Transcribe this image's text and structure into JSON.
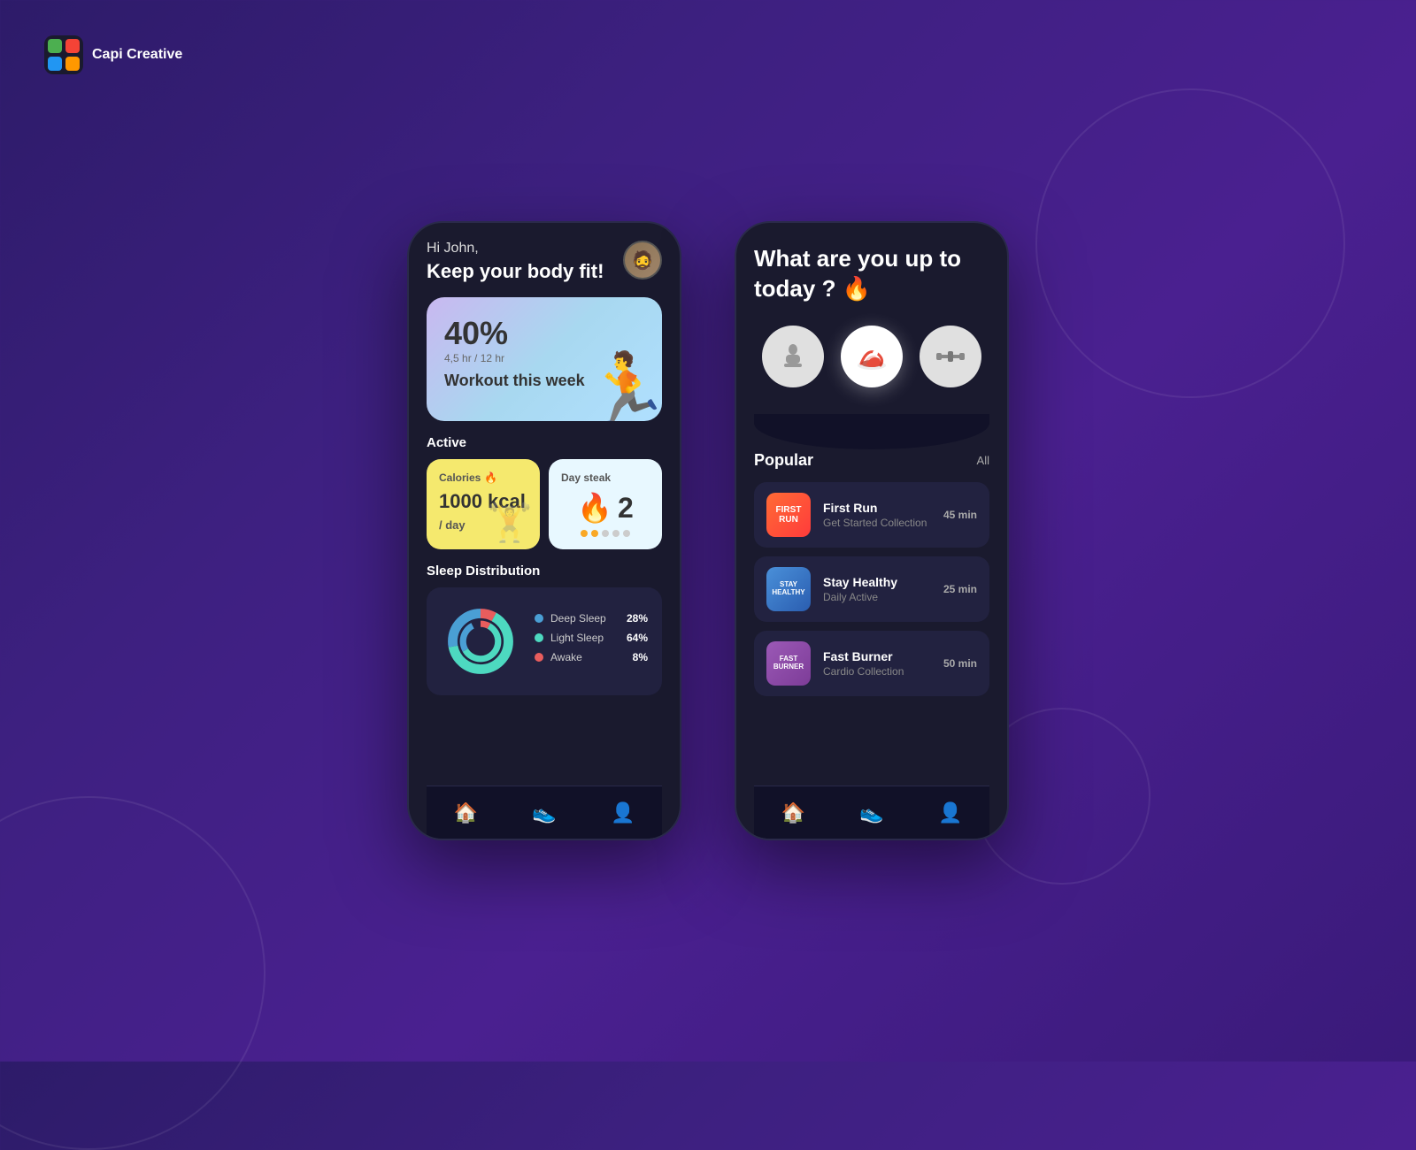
{
  "app": {
    "name": "Capi Creative",
    "logo_emoji": "🎨"
  },
  "phone1": {
    "greeting": "Hi John,",
    "title": "Keep your body fit!",
    "avatar_emoji": "🧔",
    "workout_percent": "40%",
    "workout_hours": "4,5 hr / 12 hr",
    "workout_label": "Workout this week",
    "figure_emoji": "🏋️",
    "active_label": "Active",
    "calories": {
      "label": "Calories",
      "value": "1000 kcal",
      "unit": "/ day",
      "emoji": "🔥"
    },
    "streak": {
      "label": "Day steak",
      "number": "2",
      "fire_emoji": "🔥"
    },
    "sleep_label": "Sleep Distribution",
    "sleep_items": [
      {
        "label": "Deep Sleep",
        "percent": "28%",
        "color": "#4a9fd4"
      },
      {
        "label": "Light Sleep",
        "percent": "64%",
        "color": "#4dd9c0"
      },
      {
        "label": "Awake",
        "percent": "8%",
        "color": "#e85d5d"
      }
    ],
    "nav": [
      "🏠",
      "👟",
      "👤"
    ]
  },
  "phone2": {
    "question": "What are you up to today ? 🔥",
    "activities": [
      {
        "emoji": "🏋️",
        "label": "gym",
        "selected": false
      },
      {
        "emoji": "👟",
        "label": "run",
        "selected": true
      },
      {
        "emoji": "🏋",
        "label": "weights",
        "selected": false
      }
    ],
    "popular_label": "Popular",
    "all_label": "All",
    "workouts": [
      {
        "name": "First Run",
        "sub": "Get Started Collection",
        "duration": "45 min",
        "thumb_text": "FIRST RUN",
        "thumb_class": "thumb-red"
      },
      {
        "name": "Stay Healthy",
        "sub": "Daily Active",
        "duration": "25 min",
        "thumb_text": "STAY HEALTHY",
        "thumb_class": "thumb-blue"
      },
      {
        "name": "Fast Burner",
        "sub": "Cardio Collection",
        "duration": "50 min",
        "thumb_text": "FAST BURNER",
        "thumb_class": "thumb-purple"
      }
    ],
    "nav": [
      "🏠",
      "👟",
      "👤"
    ]
  }
}
